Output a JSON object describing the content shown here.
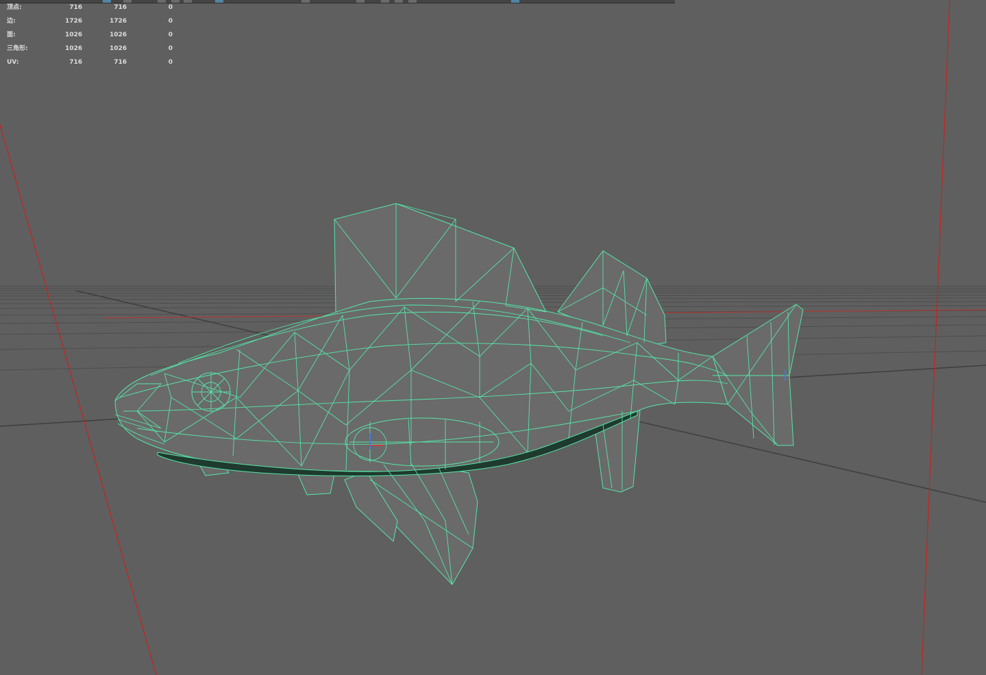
{
  "viewport": {
    "background": "#5f5f5f",
    "wireframe_color": "#55e6a8",
    "axis_color": "#c8231e"
  },
  "hud": {
    "rows": [
      {
        "label": "顶点:",
        "c1": "716",
        "c2": "716",
        "c3": "0"
      },
      {
        "label": "边:",
        "c1": "1726",
        "c2": "1726",
        "c3": "0"
      },
      {
        "label": "面:",
        "c1": "1026",
        "c2": "1026",
        "c3": "0"
      },
      {
        "label": "三角形:",
        "c1": "1026",
        "c2": "1026",
        "c3": "0"
      },
      {
        "label": "UV:",
        "c1": "716",
        "c2": "716",
        "c3": "0"
      }
    ]
  }
}
